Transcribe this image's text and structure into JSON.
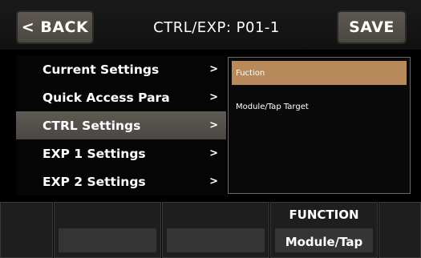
{
  "header": {
    "back_label": "< BACK",
    "title": "CTRL/EXP: P01-1",
    "save_label": "SAVE"
  },
  "menu": {
    "items": [
      {
        "label": "Current Settings",
        "arrow": ">"
      },
      {
        "label": "Quick Access Para",
        "arrow": ">"
      },
      {
        "label": "CTRL Settings",
        "arrow": ">",
        "selected": true
      },
      {
        "label": "EXP 1 Settings",
        "arrow": ">"
      },
      {
        "label": "EXP 2 Settings",
        "arrow": ">"
      }
    ]
  },
  "detail": {
    "items": [
      {
        "label": "Fuction",
        "selected": true
      },
      {
        "label": "Module/Tap Target"
      }
    ]
  },
  "bottom": {
    "function_label": "FUNCTION",
    "function_value": "Module/Tap"
  },
  "colors": {
    "selected_menu": "#55514b",
    "selected_detail": "#b8895b",
    "button": "#55514b"
  }
}
